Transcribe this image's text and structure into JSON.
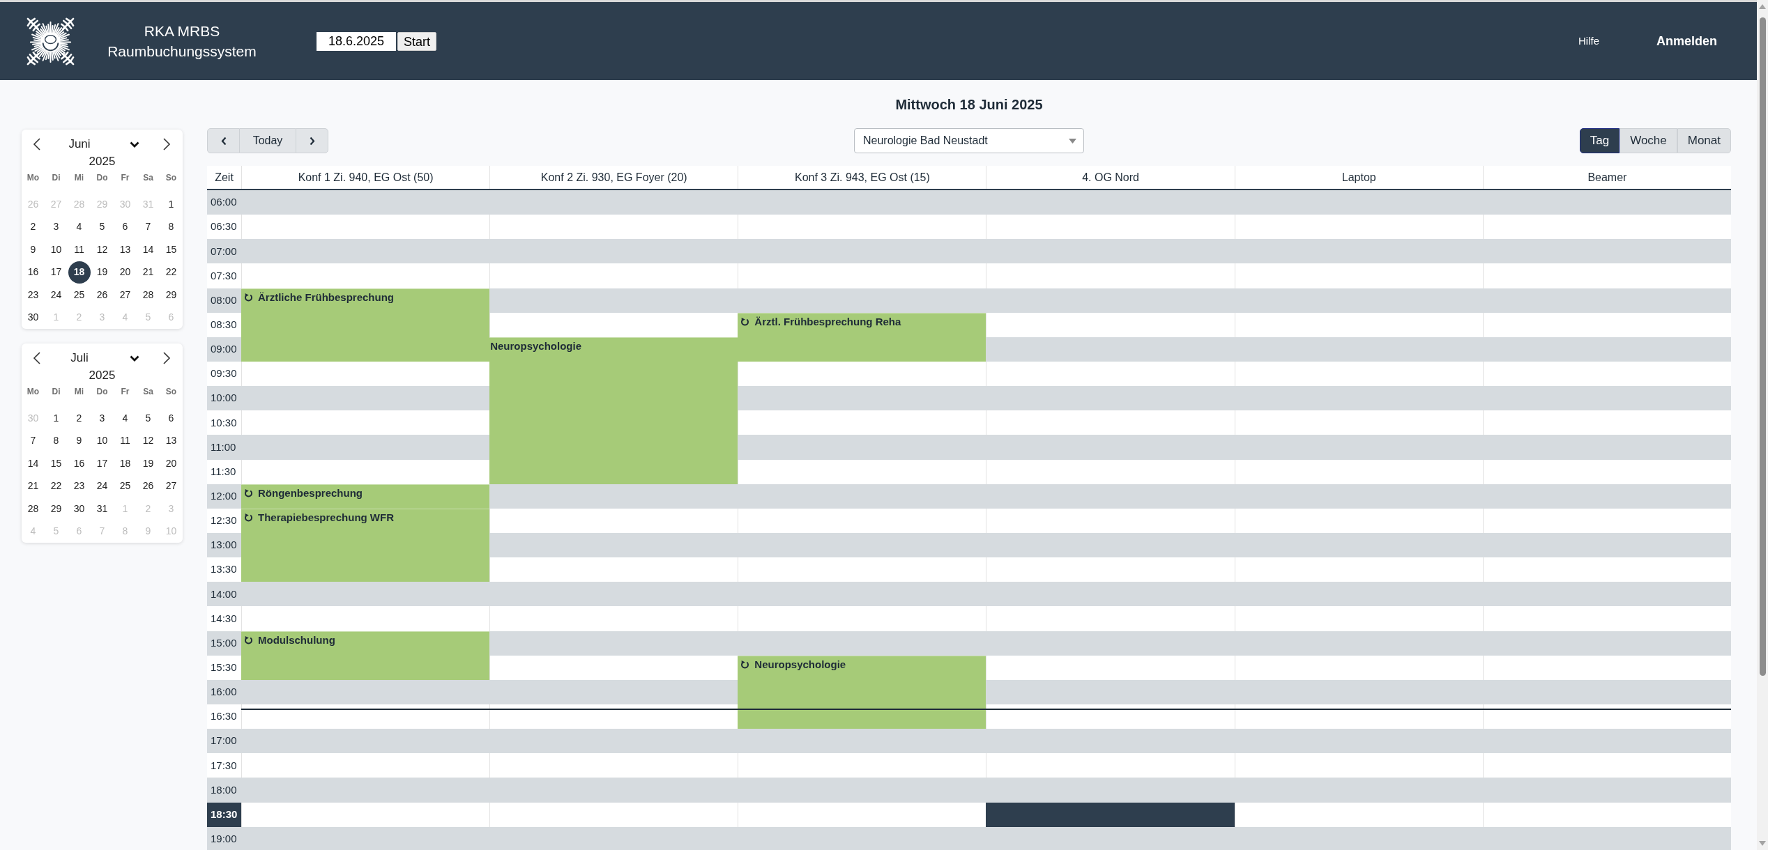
{
  "header": {
    "title": "RKA MRBS",
    "subtitle": "Raumbuchungssystem",
    "date_field": {
      "value": "18.6.2025"
    },
    "start_button": "Start",
    "help_link": "Hilfe",
    "login_link": "Anmelden"
  },
  "calendars": [
    {
      "month": "Juni",
      "year": "2025",
      "weekdays": [
        "Mo",
        "Di",
        "Mi",
        "Do",
        "Fr",
        "Sa",
        "So"
      ],
      "days": [
        {
          "label": "26",
          "outside": true,
          "selected": false
        },
        {
          "label": "27",
          "outside": true,
          "selected": false
        },
        {
          "label": "28",
          "outside": true,
          "selected": false
        },
        {
          "label": "29",
          "outside": true,
          "selected": false
        },
        {
          "label": "30",
          "outside": true,
          "selected": false
        },
        {
          "label": "31",
          "outside": true,
          "selected": false
        },
        {
          "label": "1",
          "outside": false,
          "selected": false
        },
        {
          "label": "2",
          "outside": false,
          "selected": false
        },
        {
          "label": "3",
          "outside": false,
          "selected": false
        },
        {
          "label": "4",
          "outside": false,
          "selected": false
        },
        {
          "label": "5",
          "outside": false,
          "selected": false
        },
        {
          "label": "6",
          "outside": false,
          "selected": false
        },
        {
          "label": "7",
          "outside": false,
          "selected": false
        },
        {
          "label": "8",
          "outside": false,
          "selected": false
        },
        {
          "label": "9",
          "outside": false,
          "selected": false
        },
        {
          "label": "10",
          "outside": false,
          "selected": false
        },
        {
          "label": "11",
          "outside": false,
          "selected": false
        },
        {
          "label": "12",
          "outside": false,
          "selected": false
        },
        {
          "label": "13",
          "outside": false,
          "selected": false
        },
        {
          "label": "14",
          "outside": false,
          "selected": false
        },
        {
          "label": "15",
          "outside": false,
          "selected": false
        },
        {
          "label": "16",
          "outside": false,
          "selected": false
        },
        {
          "label": "17",
          "outside": false,
          "selected": false
        },
        {
          "label": "18",
          "outside": false,
          "selected": true
        },
        {
          "label": "19",
          "outside": false,
          "selected": false
        },
        {
          "label": "20",
          "outside": false,
          "selected": false
        },
        {
          "label": "21",
          "outside": false,
          "selected": false
        },
        {
          "label": "22",
          "outside": false,
          "selected": false
        },
        {
          "label": "23",
          "outside": false,
          "selected": false
        },
        {
          "label": "24",
          "outside": false,
          "selected": false
        },
        {
          "label": "25",
          "outside": false,
          "selected": false
        },
        {
          "label": "26",
          "outside": false,
          "selected": false
        },
        {
          "label": "27",
          "outside": false,
          "selected": false
        },
        {
          "label": "28",
          "outside": false,
          "selected": false
        },
        {
          "label": "29",
          "outside": false,
          "selected": false
        },
        {
          "label": "30",
          "outside": false,
          "selected": false
        },
        {
          "label": "1",
          "outside": true,
          "selected": false
        },
        {
          "label": "2",
          "outside": true,
          "selected": false
        },
        {
          "label": "3",
          "outside": true,
          "selected": false
        },
        {
          "label": "4",
          "outside": true,
          "selected": false
        },
        {
          "label": "5",
          "outside": true,
          "selected": false
        },
        {
          "label": "6",
          "outside": true,
          "selected": false
        }
      ]
    },
    {
      "month": "Juli",
      "year": "2025",
      "weekdays": [
        "Mo",
        "Di",
        "Mi",
        "Do",
        "Fr",
        "Sa",
        "So"
      ],
      "days": [
        {
          "label": "30",
          "outside": true,
          "selected": false
        },
        {
          "label": "1",
          "outside": false,
          "selected": false
        },
        {
          "label": "2",
          "outside": false,
          "selected": false
        },
        {
          "label": "3",
          "outside": false,
          "selected": false
        },
        {
          "label": "4",
          "outside": false,
          "selected": false
        },
        {
          "label": "5",
          "outside": false,
          "selected": false
        },
        {
          "label": "6",
          "outside": false,
          "selected": false
        },
        {
          "label": "7",
          "outside": false,
          "selected": false
        },
        {
          "label": "8",
          "outside": false,
          "selected": false
        },
        {
          "label": "9",
          "outside": false,
          "selected": false
        },
        {
          "label": "10",
          "outside": false,
          "selected": false
        },
        {
          "label": "11",
          "outside": false,
          "selected": false
        },
        {
          "label": "12",
          "outside": false,
          "selected": false
        },
        {
          "label": "13",
          "outside": false,
          "selected": false
        },
        {
          "label": "14",
          "outside": false,
          "selected": false
        },
        {
          "label": "15",
          "outside": false,
          "selected": false
        },
        {
          "label": "16",
          "outside": false,
          "selected": false
        },
        {
          "label": "17",
          "outside": false,
          "selected": false
        },
        {
          "label": "18",
          "outside": false,
          "selected": false
        },
        {
          "label": "19",
          "outside": false,
          "selected": false
        },
        {
          "label": "20",
          "outside": false,
          "selected": false
        },
        {
          "label": "21",
          "outside": false,
          "selected": false
        },
        {
          "label": "22",
          "outside": false,
          "selected": false
        },
        {
          "label": "23",
          "outside": false,
          "selected": false
        },
        {
          "label": "24",
          "outside": false,
          "selected": false
        },
        {
          "label": "25",
          "outside": false,
          "selected": false
        },
        {
          "label": "26",
          "outside": false,
          "selected": false
        },
        {
          "label": "27",
          "outside": false,
          "selected": false
        },
        {
          "label": "28",
          "outside": false,
          "selected": false
        },
        {
          "label": "29",
          "outside": false,
          "selected": false
        },
        {
          "label": "30",
          "outside": false,
          "selected": false
        },
        {
          "label": "31",
          "outside": false,
          "selected": false
        },
        {
          "label": "1",
          "outside": true,
          "selected": false
        },
        {
          "label": "2",
          "outside": true,
          "selected": false
        },
        {
          "label": "3",
          "outside": true,
          "selected": false
        },
        {
          "label": "4",
          "outside": true,
          "selected": false
        },
        {
          "label": "5",
          "outside": true,
          "selected": false
        },
        {
          "label": "6",
          "outside": true,
          "selected": false
        },
        {
          "label": "7",
          "outside": true,
          "selected": false
        },
        {
          "label": "8",
          "outside": true,
          "selected": false
        },
        {
          "label": "9",
          "outside": true,
          "selected": false
        },
        {
          "label": "10",
          "outside": true,
          "selected": false
        }
      ]
    }
  ],
  "day_title": "Mittwoch 18 Juni 2025",
  "nav": {
    "today_button": "Today"
  },
  "area_select": {
    "value": "Neurologie Bad Neustadt"
  },
  "views": [
    {
      "label": "Tag",
      "selected": true
    },
    {
      "label": "Woche",
      "selected": false
    },
    {
      "label": "Monat",
      "selected": false
    }
  ],
  "grid": {
    "time_heading": "Zeit",
    "rows": [
      {
        "time": "06:00",
        "highlighted": false,
        "current": false
      },
      {
        "time": "06:30",
        "highlighted": false,
        "current": false
      },
      {
        "time": "07:00",
        "highlighted": false,
        "current": false
      },
      {
        "time": "07:30",
        "highlighted": false,
        "current": false
      },
      {
        "time": "08:00",
        "highlighted": false,
        "current": false
      },
      {
        "time": "08:30",
        "highlighted": false,
        "current": false
      },
      {
        "time": "09:00",
        "highlighted": false,
        "current": false
      },
      {
        "time": "09:30",
        "highlighted": false,
        "current": false
      },
      {
        "time": "10:00",
        "highlighted": false,
        "current": false
      },
      {
        "time": "10:30",
        "highlighted": false,
        "current": false
      },
      {
        "time": "11:00",
        "highlighted": false,
        "current": false
      },
      {
        "time": "11:30",
        "highlighted": false,
        "current": false
      },
      {
        "time": "12:00",
        "highlighted": false,
        "current": false
      },
      {
        "time": "12:30",
        "highlighted": false,
        "current": false
      },
      {
        "time": "13:00",
        "highlighted": false,
        "current": false
      },
      {
        "time": "13:30",
        "highlighted": false,
        "current": false
      },
      {
        "time": "14:00",
        "highlighted": false,
        "current": false
      },
      {
        "time": "14:30",
        "highlighted": false,
        "current": false
      },
      {
        "time": "15:00",
        "highlighted": false,
        "current": false
      },
      {
        "time": "15:30",
        "highlighted": false,
        "current": false
      },
      {
        "time": "16:00",
        "highlighted": false,
        "current": false
      },
      {
        "time": "16:30",
        "highlighted": false,
        "current": true
      },
      {
        "time": "17:00",
        "highlighted": false,
        "current": false
      },
      {
        "time": "17:30",
        "highlighted": false,
        "current": false
      },
      {
        "time": "18:00",
        "highlighted": false,
        "current": false
      },
      {
        "time": "18:30",
        "highlighted": true,
        "current": false
      },
      {
        "time": "19:00",
        "highlighted": false,
        "current": false
      }
    ],
    "rooms": [
      {
        "name": "Konf 1 Zi. 940, EG Ost (50)",
        "slots": [
          {
            "kind": "free"
          },
          {
            "kind": "free"
          },
          {
            "kind": "free"
          },
          {
            "kind": "free"
          },
          {
            "kind": "booking",
            "title": "Ärztliche Frühbesprechung",
            "recurring": true
          },
          {
            "kind": "continued"
          },
          {
            "kind": "continued"
          },
          {
            "kind": "free"
          },
          {
            "kind": "free"
          },
          {
            "kind": "free"
          },
          {
            "kind": "free"
          },
          {
            "kind": "free"
          },
          {
            "kind": "booking",
            "title": "Röngenbesprechung",
            "recurring": true
          },
          {
            "kind": "booking",
            "title": "Therapiebesprechung WFR",
            "recurring": true
          },
          {
            "kind": "continued"
          },
          {
            "kind": "continued"
          },
          {
            "kind": "free"
          },
          {
            "kind": "free"
          },
          {
            "kind": "booking",
            "title": "Modulschulung",
            "recurring": true
          },
          {
            "kind": "continued"
          },
          {
            "kind": "free"
          },
          {
            "kind": "free"
          },
          {
            "kind": "free"
          },
          {
            "kind": "free"
          },
          {
            "kind": "free"
          },
          {
            "kind": "free"
          },
          {
            "kind": "free"
          }
        ]
      },
      {
        "name": "Konf 2 Zi. 930, EG Foyer (20)",
        "slots": [
          {
            "kind": "free"
          },
          {
            "kind": "free"
          },
          {
            "kind": "free"
          },
          {
            "kind": "free"
          },
          {
            "kind": "free"
          },
          {
            "kind": "free"
          },
          {
            "kind": "booking",
            "title": "Neuropsychologie",
            "recurring": false
          },
          {
            "kind": "continued"
          },
          {
            "kind": "continued"
          },
          {
            "kind": "continued"
          },
          {
            "kind": "continued"
          },
          {
            "kind": "continued"
          },
          {
            "kind": "free"
          },
          {
            "kind": "free"
          },
          {
            "kind": "free"
          },
          {
            "kind": "free"
          },
          {
            "kind": "free"
          },
          {
            "kind": "free"
          },
          {
            "kind": "free"
          },
          {
            "kind": "free"
          },
          {
            "kind": "free"
          },
          {
            "kind": "free"
          },
          {
            "kind": "free"
          },
          {
            "kind": "free"
          },
          {
            "kind": "free"
          },
          {
            "kind": "free"
          },
          {
            "kind": "free"
          }
        ]
      },
      {
        "name": "Konf 3 Zi. 943, EG Ost (15)",
        "slots": [
          {
            "kind": "free"
          },
          {
            "kind": "free"
          },
          {
            "kind": "free"
          },
          {
            "kind": "free"
          },
          {
            "kind": "free"
          },
          {
            "kind": "booking",
            "title": "Ärztl. Frühbesprechung Reha",
            "recurring": true
          },
          {
            "kind": "continued"
          },
          {
            "kind": "free"
          },
          {
            "kind": "free"
          },
          {
            "kind": "free"
          },
          {
            "kind": "free"
          },
          {
            "kind": "free"
          },
          {
            "kind": "free"
          },
          {
            "kind": "free"
          },
          {
            "kind": "free"
          },
          {
            "kind": "free"
          },
          {
            "kind": "free"
          },
          {
            "kind": "free"
          },
          {
            "kind": "free"
          },
          {
            "kind": "booking",
            "title": "Neuropsychologie",
            "recurring": true
          },
          {
            "kind": "continued"
          },
          {
            "kind": "continued"
          },
          {
            "kind": "free"
          },
          {
            "kind": "free"
          },
          {
            "kind": "free"
          },
          {
            "kind": "free"
          },
          {
            "kind": "free"
          }
        ]
      },
      {
        "name": "4. OG Nord",
        "slots": [
          {
            "kind": "free"
          },
          {
            "kind": "free"
          },
          {
            "kind": "free"
          },
          {
            "kind": "free"
          },
          {
            "kind": "free"
          },
          {
            "kind": "free"
          },
          {
            "kind": "free"
          },
          {
            "kind": "free"
          },
          {
            "kind": "free"
          },
          {
            "kind": "free"
          },
          {
            "kind": "free"
          },
          {
            "kind": "free"
          },
          {
            "kind": "free"
          },
          {
            "kind": "free"
          },
          {
            "kind": "free"
          },
          {
            "kind": "free"
          },
          {
            "kind": "free"
          },
          {
            "kind": "free"
          },
          {
            "kind": "free"
          },
          {
            "kind": "free"
          },
          {
            "kind": "free"
          },
          {
            "kind": "free"
          },
          {
            "kind": "free"
          },
          {
            "kind": "free"
          },
          {
            "kind": "free"
          },
          {
            "kind": "highlighted"
          },
          {
            "kind": "free"
          }
        ]
      },
      {
        "name": "Laptop",
        "slots": [
          {
            "kind": "free"
          },
          {
            "kind": "free"
          },
          {
            "kind": "free"
          },
          {
            "kind": "free"
          },
          {
            "kind": "free"
          },
          {
            "kind": "free"
          },
          {
            "kind": "free"
          },
          {
            "kind": "free"
          },
          {
            "kind": "free"
          },
          {
            "kind": "free"
          },
          {
            "kind": "free"
          },
          {
            "kind": "free"
          },
          {
            "kind": "free"
          },
          {
            "kind": "free"
          },
          {
            "kind": "free"
          },
          {
            "kind": "free"
          },
          {
            "kind": "free"
          },
          {
            "kind": "free"
          },
          {
            "kind": "free"
          },
          {
            "kind": "free"
          },
          {
            "kind": "free"
          },
          {
            "kind": "free"
          },
          {
            "kind": "free"
          },
          {
            "kind": "free"
          },
          {
            "kind": "free"
          },
          {
            "kind": "free"
          },
          {
            "kind": "free"
          }
        ]
      },
      {
        "name": "Beamer",
        "slots": [
          {
            "kind": "free"
          },
          {
            "kind": "free"
          },
          {
            "kind": "free"
          },
          {
            "kind": "free"
          },
          {
            "kind": "free"
          },
          {
            "kind": "free"
          },
          {
            "kind": "free"
          },
          {
            "kind": "free"
          },
          {
            "kind": "free"
          },
          {
            "kind": "free"
          },
          {
            "kind": "free"
          },
          {
            "kind": "free"
          },
          {
            "kind": "free"
          },
          {
            "kind": "free"
          },
          {
            "kind": "free"
          },
          {
            "kind": "free"
          },
          {
            "kind": "free"
          },
          {
            "kind": "free"
          },
          {
            "kind": "free"
          },
          {
            "kind": "free"
          },
          {
            "kind": "free"
          },
          {
            "kind": "free"
          },
          {
            "kind": "free"
          },
          {
            "kind": "free"
          },
          {
            "kind": "free"
          },
          {
            "kind": "free"
          },
          {
            "kind": "free"
          }
        ]
      }
    ]
  }
}
